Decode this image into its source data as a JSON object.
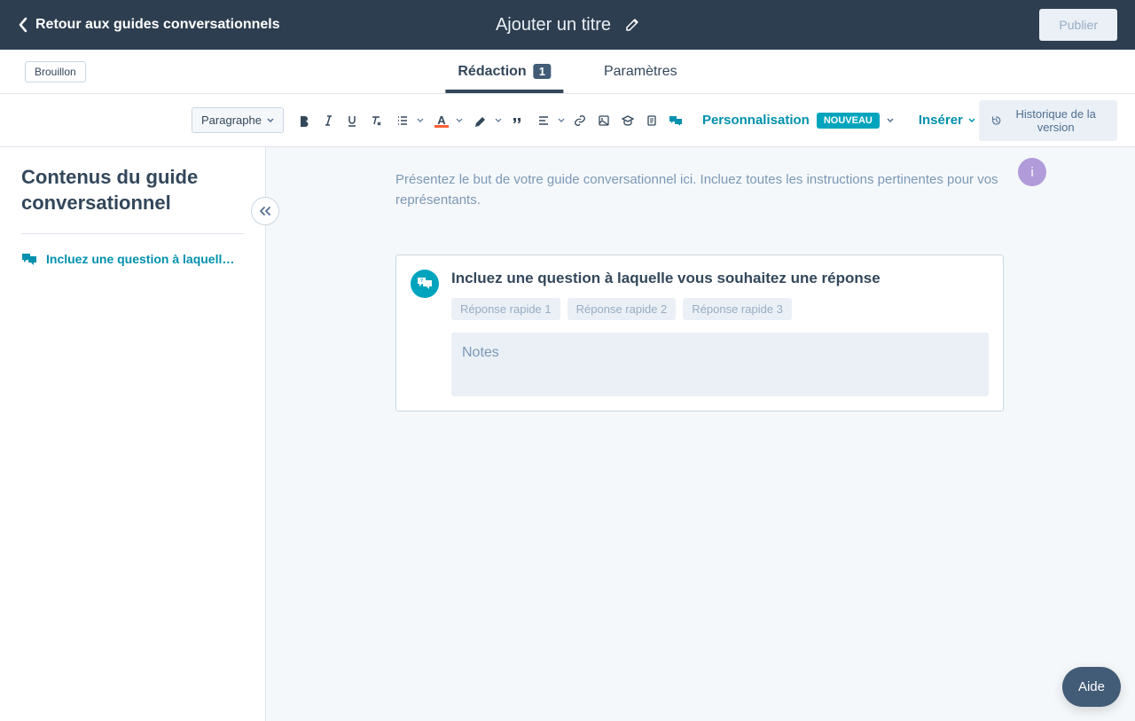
{
  "header": {
    "back_label": "Retour aux guides conversationnels",
    "title_placeholder": "Ajouter un titre",
    "publish_label": "Publier"
  },
  "subheader": {
    "status": "Brouillon",
    "tabs": {
      "redaction": {
        "label": "Rédaction",
        "badge": "1"
      },
      "parametres": {
        "label": "Paramètres"
      }
    }
  },
  "toolbar": {
    "paragraph": "Paragraphe",
    "personalisation": {
      "label": "Personnalisation",
      "badge": "NOUVEAU"
    },
    "insert": "Insérer",
    "history": "Historique de la version",
    "text_color": "#ff5c35"
  },
  "sidebar": {
    "title": "Contenus du guide conversationnel",
    "items": [
      {
        "label": "Incluez une question à laquell…"
      }
    ]
  },
  "content": {
    "avatar_initial": "i",
    "intro": "Présentez le but de votre guide conversationnel ici. Incluez toutes les instructions pertinentes pour vos représentants.",
    "question": {
      "title": "Incluez une question à laquelle vous souhaitez une réponse",
      "quick_answers": [
        "Réponse rapide 1",
        "Réponse rapide 2",
        "Réponse rapide 3"
      ],
      "notes_placeholder": "Notes"
    }
  },
  "help": {
    "label": "Aide"
  }
}
